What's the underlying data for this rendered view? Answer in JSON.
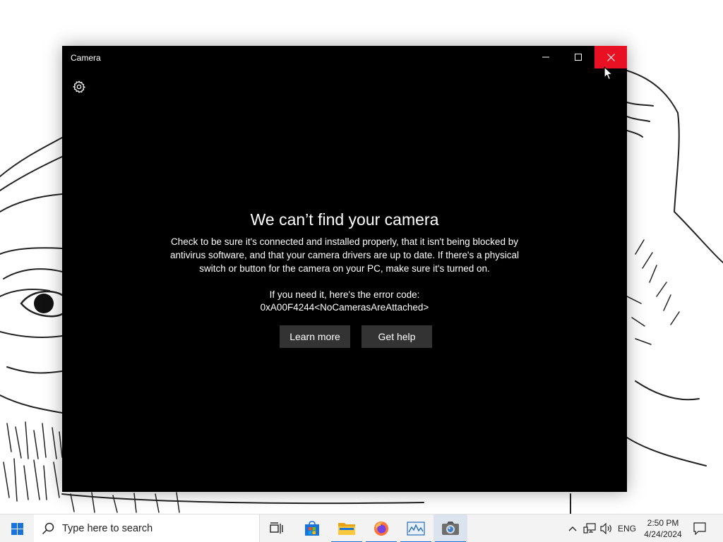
{
  "window": {
    "title": "Camera",
    "error_title": "We can’t find your camera",
    "error_description": "Check to be sure it's connected and installed properly, that it isn't being blocked by antivirus software, and that your camera drivers are up to date. If there's a physical switch or button for the camera on your PC, make sure it's turned on.",
    "error_code_label": "If you need it, here's the error code:",
    "error_code": "0xA00F4244<NoCamerasAreAttached>",
    "learn_more_label": "Learn more",
    "get_help_label": "Get help",
    "icons": [
      "minimize-icon",
      "maximize-icon",
      "close-icon",
      "gear-icon"
    ],
    "close_hover_color": "#e81123"
  },
  "taskbar": {
    "search_placeholder": "Type here to search",
    "apps": [
      "task-view-icon",
      "microsoft-store-icon",
      "file-explorer-icon",
      "firefox-icon",
      "performance-monitor-icon",
      "camera-icon"
    ],
    "language": "ENG",
    "time": "2:50 PM",
    "date": "4/24/2024",
    "accent_color": "#1a73d9"
  }
}
